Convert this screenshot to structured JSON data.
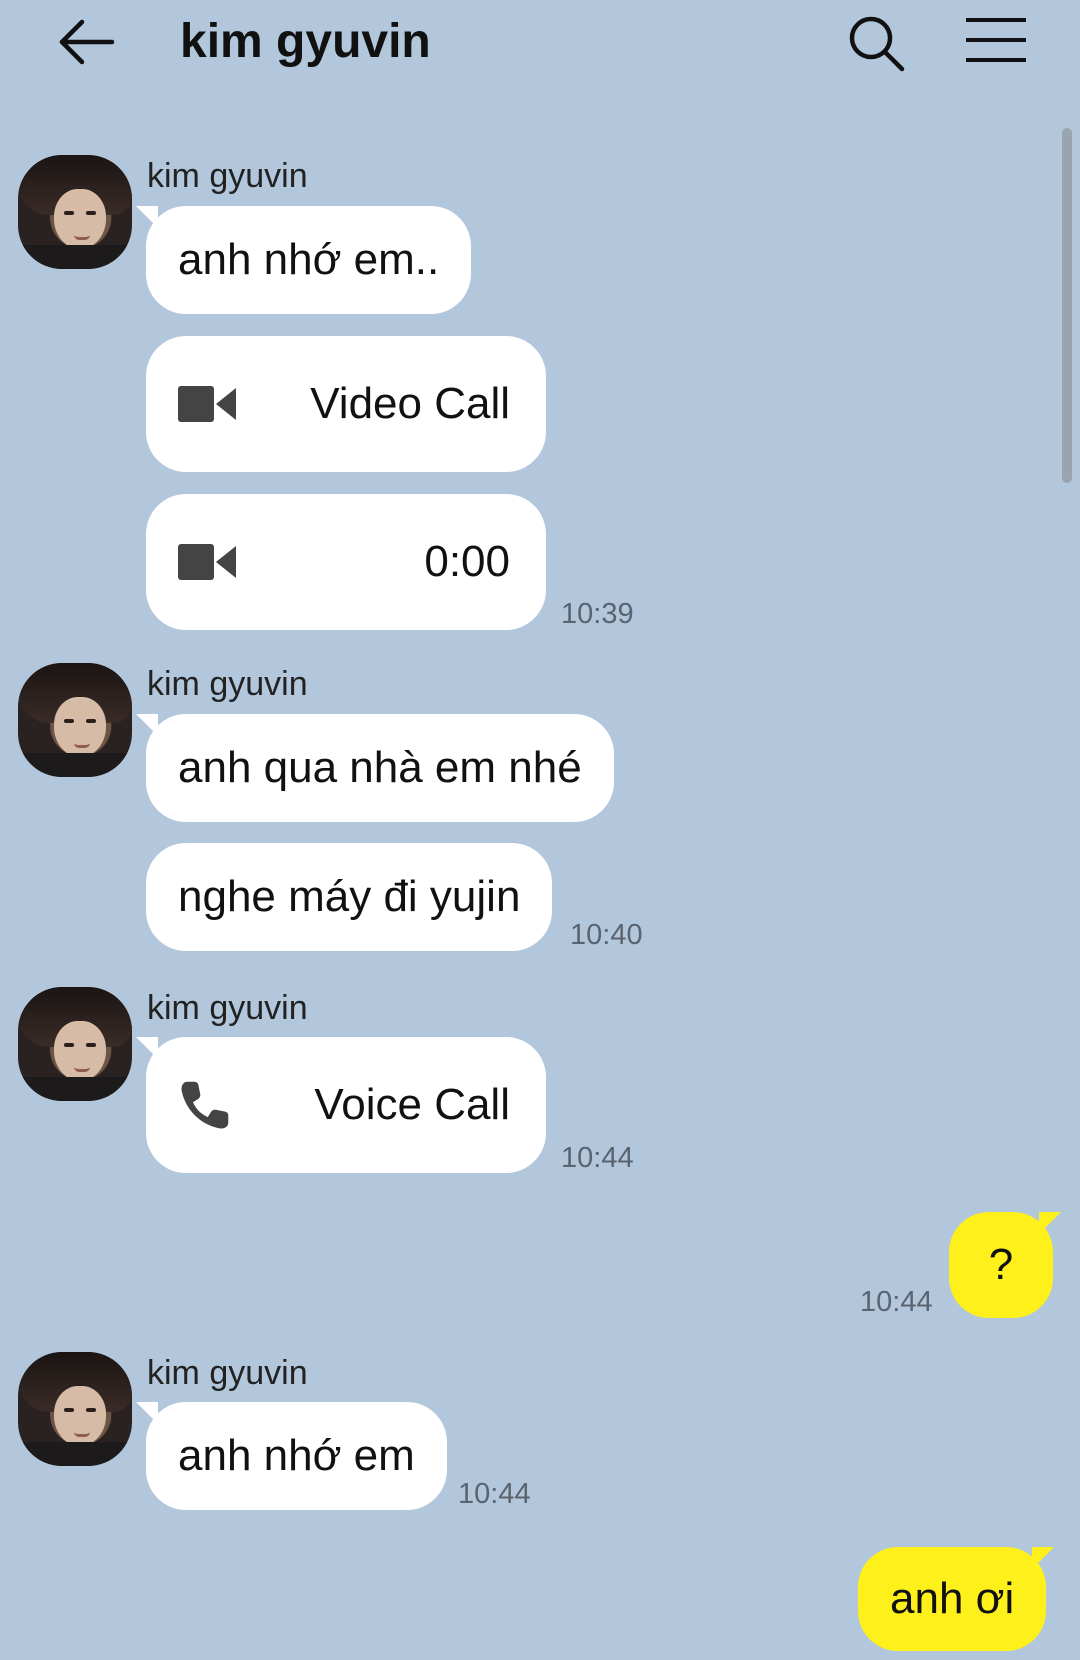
{
  "header": {
    "title": "kim gyuvin"
  },
  "messages": [
    {
      "sender": "kim gyuvin",
      "text": "anh nhớ em..",
      "type": "text"
    },
    {
      "type": "video-call",
      "label": "Video Call"
    },
    {
      "type": "video-call",
      "label": "0:00",
      "time": "10:39"
    },
    {
      "sender": "kim gyuvin",
      "text": "anh qua nhà em nhé",
      "type": "text"
    },
    {
      "text": "nghe máy đi yujin",
      "type": "text",
      "time": "10:40"
    },
    {
      "sender": "kim gyuvin",
      "type": "voice-call",
      "label": "Voice Call",
      "time": "10:44"
    },
    {
      "from_me": true,
      "text": "?",
      "time": "10:44"
    },
    {
      "sender": "kim gyuvin",
      "text": "anh nhớ em",
      "type": "text",
      "time": "10:44"
    },
    {
      "from_me": true,
      "text": "anh ơi"
    }
  ],
  "icons": {
    "back": "arrow-left-icon",
    "search": "search-icon",
    "menu": "hamburger-menu-icon",
    "video": "video-camera-icon",
    "phone": "phone-icon"
  },
  "colors": {
    "background": "#b3c7dc",
    "incoming_bubble": "#ffffff",
    "outgoing_bubble": "#fef01b"
  }
}
